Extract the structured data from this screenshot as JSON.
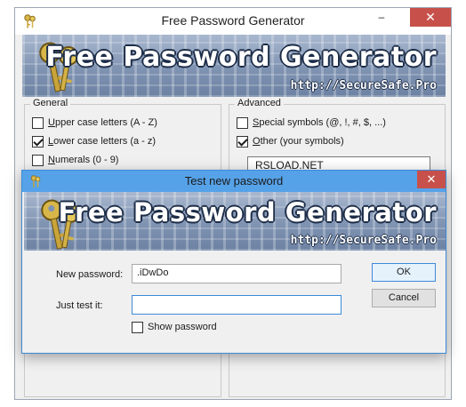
{
  "main_window": {
    "title": "Free Password Generator",
    "controls": {
      "minimize": "–",
      "maximize": "□",
      "close": "✕"
    },
    "banner": {
      "title": "Free Password Generator",
      "url": "http://SecureSafe.Pro"
    },
    "general": {
      "title": "General",
      "options": [
        {
          "prefix": "",
          "hotkey": "U",
          "rest": "pper case letters (A - Z)",
          "checked": false
        },
        {
          "prefix": "",
          "hotkey": "L",
          "rest": "ower case letters (a - z)",
          "checked": true
        },
        {
          "prefix": "",
          "hotkey": "N",
          "rest": "umerals (0 - 9)",
          "checked": false
        }
      ]
    },
    "advanced": {
      "title": "Advanced",
      "options": [
        {
          "prefix": "",
          "hotkey": "S",
          "rest": "pecial symbols (@, !, #, $, ...)",
          "checked": false
        },
        {
          "prefix": "",
          "hotkey": "O",
          "rest": "ther (your symbols)",
          "checked": true
        }
      ],
      "other_symbols_value": "RSLOAD.NET"
    }
  },
  "dialog": {
    "title": "Test new password",
    "close": "✕",
    "banner": {
      "title": "Free Password Generator",
      "url": "http://SecureSafe.Pro"
    },
    "new_password_label": "New password:",
    "new_password_value": ".iDwDo",
    "just_test_label": "Just test it:",
    "just_test_value": "",
    "show_password_label": "Show password",
    "show_password_checked": false,
    "ok_label": "OK",
    "cancel_label": "Cancel"
  },
  "colors": {
    "dialog_titlebar": "#56a2e8",
    "close_button": "#c7514a",
    "banner": "#7f93b2"
  },
  "icons": [
    "keys-icon",
    "minimize-icon",
    "maximize-icon",
    "close-icon",
    "checkbox-icon"
  ]
}
